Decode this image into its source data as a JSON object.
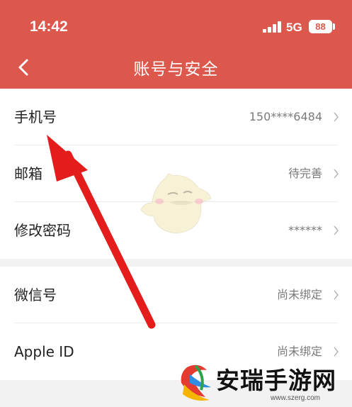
{
  "status_bar": {
    "time": "14:42",
    "network": "5G",
    "battery": "88"
  },
  "header": {
    "title": "账号与安全",
    "accent_color": "#dc584c"
  },
  "rows": [
    {
      "label": "手机号",
      "value": "150****6484"
    },
    {
      "label": "邮箱",
      "value": "待完善"
    },
    {
      "label": "修改密码",
      "value": "******"
    },
    {
      "label": "微信号",
      "value": "尚未绑定"
    },
    {
      "label": "Apple ID",
      "value": "尚未绑定"
    }
  ],
  "watermark": {
    "text": "安瑞手游网",
    "url": "www.szerg.com"
  },
  "icons": [
    "back-icon",
    "chevron-right-icon",
    "signal-icon",
    "battery-icon",
    "mascot-icon",
    "arrow-annotation"
  ]
}
